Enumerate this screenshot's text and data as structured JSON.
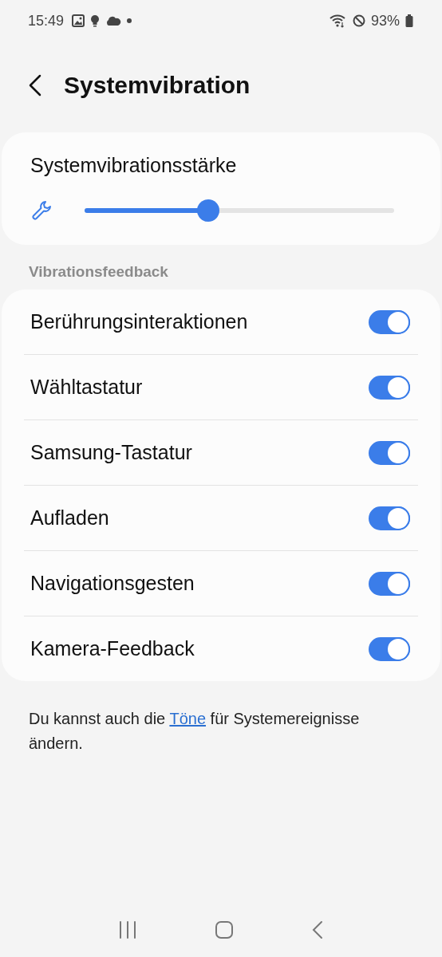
{
  "status_bar": {
    "time": "15:49",
    "battery": "93%"
  },
  "header": {
    "title": "Systemvibration"
  },
  "intensity": {
    "title": "Systemvibrationsstärke",
    "level": 0.4
  },
  "section": {
    "title": "Vibrationsfeedback"
  },
  "items": [
    {
      "label": "Berührungsinteraktionen",
      "on": true
    },
    {
      "label": "Wähltastatur",
      "on": true
    },
    {
      "label": "Samsung-Tastatur",
      "on": true
    },
    {
      "label": "Aufladen",
      "on": true
    },
    {
      "label": "Navigationsgesten",
      "on": true
    },
    {
      "label": "Kamera-Feedback",
      "on": true
    }
  ],
  "footer": {
    "before": "Du kannst auch die ",
    "link": "Töne",
    "after": " für Systemereignisse ändern."
  }
}
